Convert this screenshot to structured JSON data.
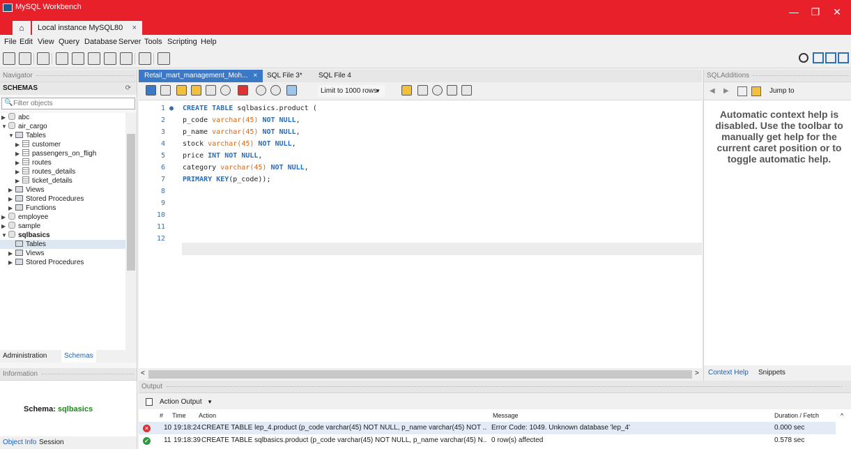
{
  "window": {
    "title": "MySQL Workbench",
    "minimize": "—",
    "restore": "❐",
    "close": "✕"
  },
  "tabs": {
    "home_icon": "home-icon",
    "connection": "Local instance MySQL80",
    "close": "×"
  },
  "menu": [
    "File",
    "Edit",
    "View",
    "Query",
    "Database",
    "Server",
    "Tools",
    "Scripting",
    "Help"
  ],
  "navigator": {
    "header": "Navigator",
    "schemas_label": "SCHEMAS",
    "filter_placeholder": "Filter objects",
    "tree": [
      {
        "label": "abc",
        "level": 0,
        "type": "db",
        "expanded": false
      },
      {
        "label": "air_cargo",
        "level": 0,
        "type": "db",
        "expanded": true
      },
      {
        "label": "Tables",
        "level": 1,
        "type": "folder",
        "expanded": true
      },
      {
        "label": "customer",
        "level": 2,
        "type": "table"
      },
      {
        "label": "passengers_on_fligh",
        "level": 2,
        "type": "table"
      },
      {
        "label": "routes",
        "level": 2,
        "type": "table"
      },
      {
        "label": "routes_details",
        "level": 2,
        "type": "table"
      },
      {
        "label": "ticket_details",
        "level": 2,
        "type": "table"
      },
      {
        "label": "Views",
        "level": 1,
        "type": "folder"
      },
      {
        "label": "Stored Procedures",
        "level": 1,
        "type": "folder"
      },
      {
        "label": "Functions",
        "level": 1,
        "type": "folder"
      },
      {
        "label": "employee",
        "level": 0,
        "type": "db"
      },
      {
        "label": "sample",
        "level": 0,
        "type": "db"
      },
      {
        "label": "sqlbasics",
        "level": 0,
        "type": "db",
        "expanded": true,
        "bold": true
      },
      {
        "label": "Tables",
        "level": 1,
        "type": "folder",
        "selected": true
      },
      {
        "label": "Views",
        "level": 1,
        "type": "folder"
      },
      {
        "label": "Stored Procedures",
        "level": 1,
        "type": "folder"
      }
    ],
    "tab_administration": "Administration",
    "tab_schemas": "Schemas",
    "info_header": "Information",
    "schema_label": "Schema:",
    "schema_value": "sqlbasics",
    "tab_object_info": "Object Info",
    "tab_session": "Session"
  },
  "editor": {
    "tabs": [
      {
        "label": "Retail_mart_management_Moh...",
        "active": true
      },
      {
        "label": "SQL File 3*",
        "active": false
      },
      {
        "label": "SQL File 4",
        "active": false
      }
    ],
    "limit": "Limit to 1000 rows",
    "lines": [
      "CREATE TABLE sqlbasics.product (",
      "p_code varchar(45) NOT NULL,",
      "p_name varchar(45) NOT NULL,",
      "stock varchar(45) NOT NULL,",
      "price INT NOT NULL,",
      "category varchar(45) NOT NULL,",
      "PRIMARY KEY(p_code));",
      "",
      "",
      "",
      "",
      ""
    ]
  },
  "sql_additions": {
    "header": "SQLAdditions",
    "jump_to": "Jump to",
    "help_lines": [
      "Automatic context help is",
      "disabled. Use the toolbar to",
      "manually get help for the",
      "current caret position or to",
      "toggle automatic help."
    ],
    "tab_context_help": "Context Help",
    "tab_snippets": "Snippets"
  },
  "output": {
    "header": "Output",
    "selector": "Action Output",
    "columns": [
      "#",
      "Time",
      "Action",
      "Message",
      "Duration / Fetch"
    ],
    "rows": [
      {
        "status": "error",
        "num": "10",
        "time": "19:18:24",
        "action": "CREATE TABLE lep_4.product (p_code varchar(45) NOT NULL, p_name varchar(45) NOT ...",
        "message": "Error Code: 1049. Unknown database 'lep_4'",
        "duration": "0.000 sec"
      },
      {
        "status": "ok",
        "num": "11",
        "time": "19:18:39",
        "action": "CREATE TABLE sqlbasics.product (p_code varchar(45) NOT NULL, p_name varchar(45) N...",
        "message": "0 row(s) affected",
        "duration": "0.578 sec"
      }
    ]
  }
}
